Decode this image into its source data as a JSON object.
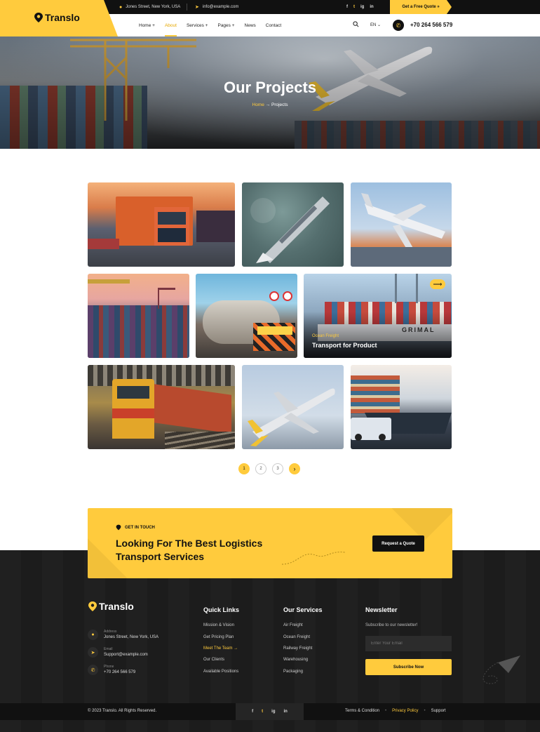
{
  "topbar": {
    "address": "Jones Street, New York, USA",
    "email": "info@example.com",
    "social": [
      "f",
      "t",
      "ig",
      "in"
    ],
    "quote_label": "Get a Free Quote »"
  },
  "brand": {
    "name": "Translo",
    "accent": "#ffcb3d",
    "dark": "#111111"
  },
  "nav": {
    "items": [
      "Home +",
      "About",
      "Services +",
      "Pages +",
      "News",
      "Contact"
    ],
    "active": "About",
    "lang": "EN ⌄",
    "phone": "+70 264 566 579"
  },
  "hero": {
    "title": "Our Projects",
    "breadcrumb_home": "Home",
    "breadcrumb_sep": "→",
    "breadcrumb_current": "Projects"
  },
  "gallery": {
    "featured": {
      "category": "Ocean Freight",
      "title": "Transport for Product",
      "arrow": "⟶"
    }
  },
  "pagination": {
    "pages": [
      "1",
      "2",
      "3"
    ],
    "current": "1",
    "next": "›"
  },
  "cta": {
    "kicker": "GET IN TOUCH",
    "title": "Looking For The Best Logistics Transport Services",
    "button": "Request a Quote"
  },
  "footer": {
    "contact": [
      {
        "label": "Address",
        "value": "Jones Street, New York, USA",
        "icon": "location-icon"
      },
      {
        "label": "Email",
        "value": "Support@example.com",
        "icon": "send-icon"
      },
      {
        "label": "Phone",
        "value": "+70 264 566 579",
        "icon": "phone-icon"
      }
    ],
    "quick_links": {
      "title": "Quick Links",
      "items": [
        "Mission & Vision",
        "Get Pricing Plan",
        "Meet The Team →",
        "Our Clients",
        "Available Positions"
      ],
      "highlighted": "Meet The Team →"
    },
    "services": {
      "title": "Our Services",
      "items": [
        "Air Freight",
        "Ocean Freight",
        "Railway Freight",
        "Warehousing",
        "Packaging"
      ]
    },
    "newsletter": {
      "title": "Newsletter",
      "text": "Subscribe to our newsletter!",
      "placeholder": "Enter Your Email",
      "button": "Subscribe Now"
    },
    "copyright": "© 2023 Translo. All Rights Reserved.",
    "bottom_social": [
      "f",
      "t",
      "ig",
      "in"
    ],
    "bottom_links": [
      "Terms & Condition",
      "Privacy Policy",
      "Support"
    ]
  }
}
